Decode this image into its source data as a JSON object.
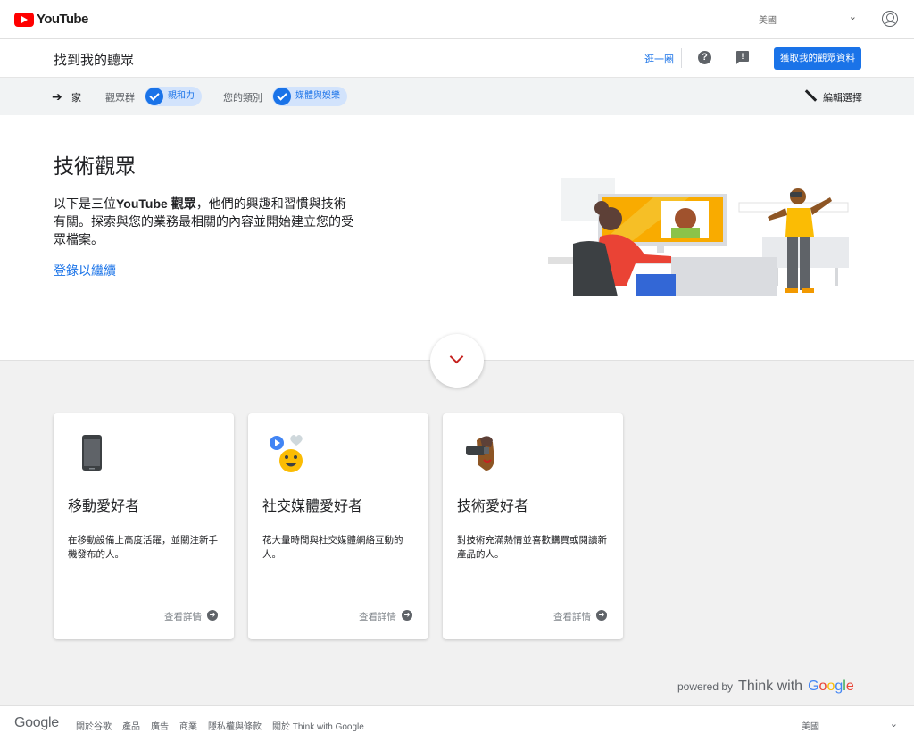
{
  "topbar": {
    "brand": "YouTube",
    "country": "美國"
  },
  "header": {
    "title": "找到我的聽眾",
    "tour_link": "逛一圈",
    "cta_label": "獲取我的觀眾資料"
  },
  "filters": {
    "home": "家",
    "audience_label": "觀眾群",
    "audience_value": "親和力",
    "category_label": "您的類別",
    "category_value": "媒體與娛樂",
    "edit_label": "編輯選擇"
  },
  "hero": {
    "title": "技術觀眾",
    "desc_prefix": "以下是三位",
    "desc_bold": "YouTube 觀眾",
    "desc_suffix": "，他們的興趣和習慣與技術有關。探索與您的業務最相關的內容並開始建立您的受眾檔案。",
    "login_link": "登錄以繼續"
  },
  "cards": [
    {
      "icon": "smartphone-icon",
      "title": "移動愛好者",
      "desc": "在移動設備上高度活躍，並關注新手機發布的人。",
      "more": "查看詳情"
    },
    {
      "icon": "social-media-icon",
      "title": "社交媒體愛好者",
      "desc": "花大量時間與社交媒體網絡互動的人。",
      "more": "查看詳情"
    },
    {
      "icon": "vr-headset-icon",
      "title": "技術愛好者",
      "desc": "對技術充滿熱情並喜歡購買或閱讀新產品的人。",
      "more": "查看詳情"
    }
  ],
  "powered": {
    "prefix": "powered by",
    "think_with": "Think with",
    "google": "Google"
  },
  "footer": {
    "logo": "Google",
    "links": [
      "關於谷歌",
      "產品",
      "廣告",
      "商業",
      "隱私權與條款",
      "關於 Think with Google"
    ],
    "country": "美國"
  }
}
